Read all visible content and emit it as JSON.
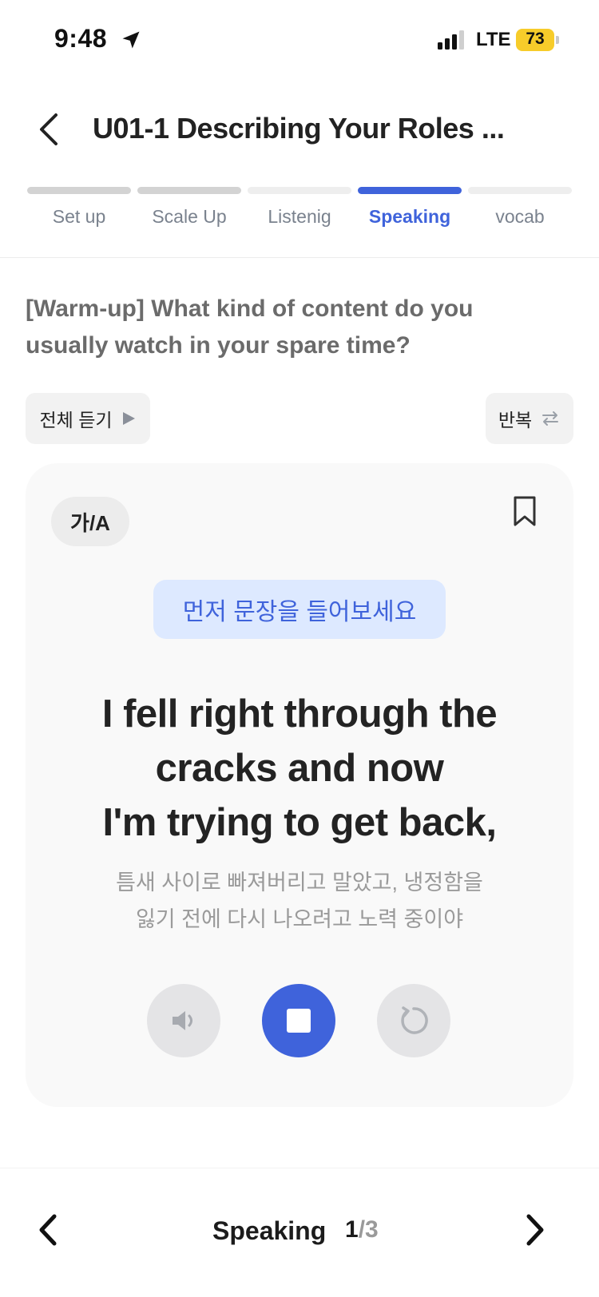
{
  "status_bar": {
    "time": "9:48",
    "network": "LTE",
    "battery": "73"
  },
  "header": {
    "title": "U01-1 Describing Your Roles ..."
  },
  "steps": [
    {
      "label": "Set up",
      "state": "done"
    },
    {
      "label": "Scale Up",
      "state": "done"
    },
    {
      "label": "Listenig",
      "state": "todo"
    },
    {
      "label": "Speaking",
      "state": "active"
    },
    {
      "label": "vocab",
      "state": "todo"
    }
  ],
  "question": "[Warm-up] What kind of content do you usually watch in your spare time?",
  "controls": {
    "listen_all_label": "전체 듣기",
    "repeat_label": "반복"
  },
  "card": {
    "lang_toggle": "가/A",
    "hint": "먼저 문장을 들어보세요",
    "sentence_lines": [
      "I fell right through the",
      "cracks and now",
      "I'm trying to get back,"
    ],
    "translation_lines": [
      "틈새 사이로 빠져버리고 말았고, 냉정함을",
      "잃기 전에 다시 나오려고 노력 중이야"
    ]
  },
  "bottom_nav": {
    "title": "Speaking",
    "current_page": "1",
    "total_pages": "/3"
  },
  "colors": {
    "accent": "#3f63db",
    "hint_bg": "#dde9ff",
    "battery": "#f7cc2a"
  },
  "icons": [
    "location-arrow-icon",
    "signal-icon",
    "back-chevron-icon",
    "play-icon",
    "repeat-icon",
    "bookmark-icon",
    "speaker-icon",
    "stop-icon",
    "retry-icon",
    "chevron-left-icon",
    "chevron-right-icon"
  ]
}
